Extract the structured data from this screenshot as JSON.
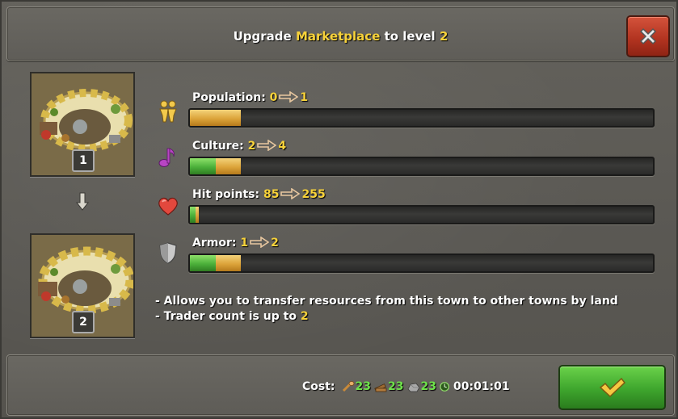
{
  "dialog": {
    "title_prefix": "Upgrade ",
    "building": "Marketplace",
    "title_middle": " to level ",
    "target_level": "2"
  },
  "thumbs": {
    "current_level": "1",
    "next_level": "2"
  },
  "stats": [
    {
      "label": "Population:",
      "from": "0",
      "to": "1",
      "icon": "population-icon",
      "fill_green": 0.0,
      "fill_yellow": 0.11
    },
    {
      "label": "Culture:",
      "from": "2",
      "to": "4",
      "icon": "culture-icon",
      "fill_green": 0.055,
      "fill_yellow": 0.11
    },
    {
      "label": "Hit points:",
      "from": "85",
      "to": "255",
      "icon": "heart-icon",
      "fill_green": 0.012,
      "fill_yellow": 0.02
    },
    {
      "label": "Armor:",
      "from": "1",
      "to": "2",
      "icon": "shield-icon",
      "fill_green": 0.055,
      "fill_yellow": 0.11
    }
  ],
  "description": {
    "line1": "- Allows you to transfer resources from this town to other towns by land",
    "line2_prefix": "- Trader count is up to ",
    "line2_value": "2"
  },
  "cost": {
    "label": "Cost:",
    "wood": "23",
    "food": "23",
    "stone": "23",
    "time": "00:01:01"
  },
  "colors": {
    "highlight": "#f7d23a",
    "cost_value": "#6ee14a",
    "bar_green": "#4bb03a",
    "bar_yellow": "#dca43a",
    "close_red": "#b0321f",
    "confirm_green": "#3ea52d"
  }
}
